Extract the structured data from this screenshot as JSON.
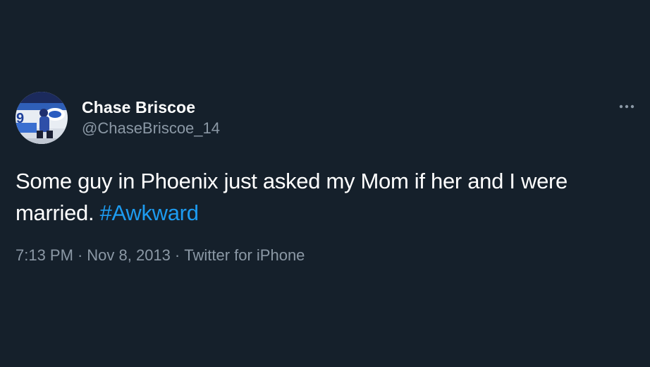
{
  "tweet": {
    "author": {
      "display_name": "Chase Briscoe",
      "handle": "@ChaseBriscoe_14",
      "avatar_icon": "profile-photo-race-car"
    },
    "more_icon": "ellipsis-icon",
    "text_before": "Some guy in Phoenix just asked my Mom if her and I were married. ",
    "hashtag": "#Awkward",
    "time": "7:13 PM",
    "separator": "·",
    "date": "Nov 8, 2013",
    "source": "Twitter for iPhone"
  },
  "colors": {
    "background": "#15202b",
    "text": "#ffffff",
    "secondary": "#8b98a5",
    "accent": "#1d9bf0"
  }
}
